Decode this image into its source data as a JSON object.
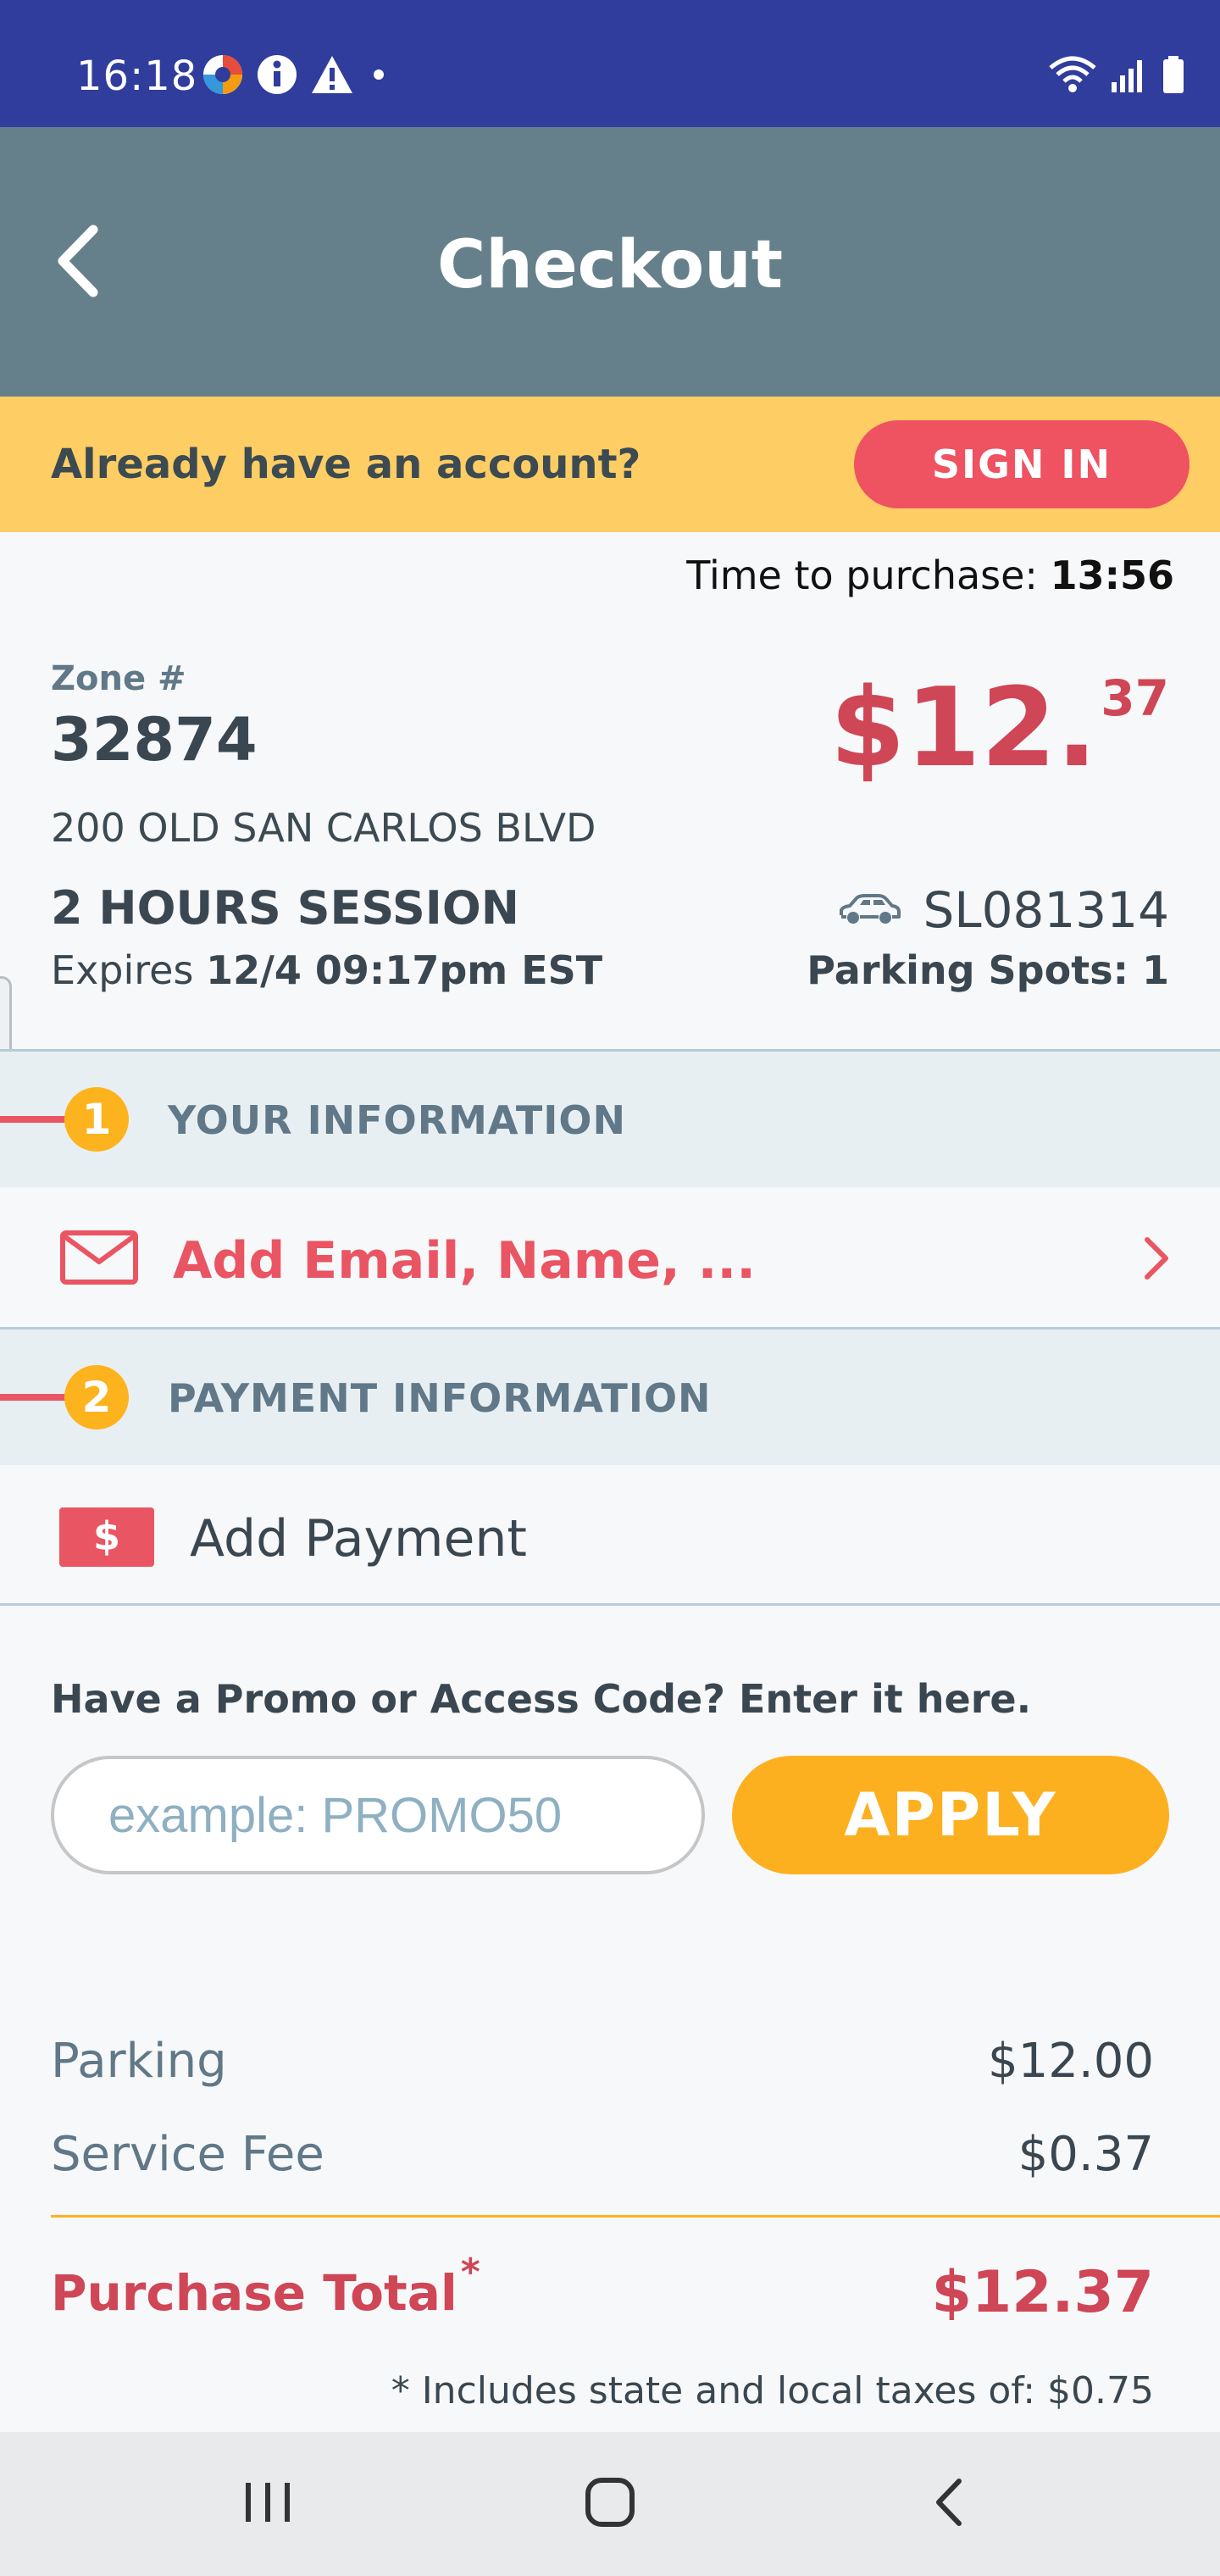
{
  "status_bar": {
    "time": "16:18",
    "left_icons": [
      "app-notification-icon",
      "info-icon",
      "warning-icon",
      "dot-icon"
    ],
    "right_icons": [
      "wifi-icon",
      "signal-icon",
      "battery-icon"
    ]
  },
  "app_bar": {
    "title": "Checkout",
    "back_icon": "chevron-left-icon"
  },
  "account_banner": {
    "text": "Already have an account?",
    "sign_in_label": "SIGN IN"
  },
  "timer": {
    "label": "Time to purchase:",
    "value": "13:56"
  },
  "summary": {
    "zone_label": "Zone #",
    "zone_number": "32874",
    "price_dollars": "$12.",
    "price_cents": "37",
    "address": "200 OLD SAN CARLOS BLVD",
    "session": "2 HOURS  SESSION",
    "expires_label": "Expires",
    "expires_value": "12/4 09:17pm EST",
    "plate": "SL081314",
    "parking_spots": "Parking Spots: 1"
  },
  "sections": {
    "your_info": {
      "step": "1",
      "title": "YOUR INFORMATION",
      "row_label": "Add Email, Name, ..."
    },
    "payment_info": {
      "step": "2",
      "title": "PAYMENT INFORMATION",
      "row_label": "Add Payment",
      "row_icon_text": "$"
    }
  },
  "promo": {
    "label": "Have a Promo or Access Code? Enter it here.",
    "placeholder": "example: PROMO50",
    "value": "",
    "apply_label": "APPLY"
  },
  "totals": {
    "lines": [
      {
        "label": "Parking",
        "value": "$12.00"
      },
      {
        "label": "Service Fee",
        "value": "$0.37"
      }
    ],
    "total_label": "Purchase Total",
    "total_marker": "*",
    "total_value": "$12.37",
    "tax_note": "* Includes state and local taxes of: $0.75"
  },
  "colors": {
    "status_bar": "#303d9c",
    "app_bar": "#66808b",
    "banner": "#fecd64",
    "accent_red": "#ef5261",
    "price_red": "#cf4656",
    "accent_orange": "#fdb01f"
  }
}
